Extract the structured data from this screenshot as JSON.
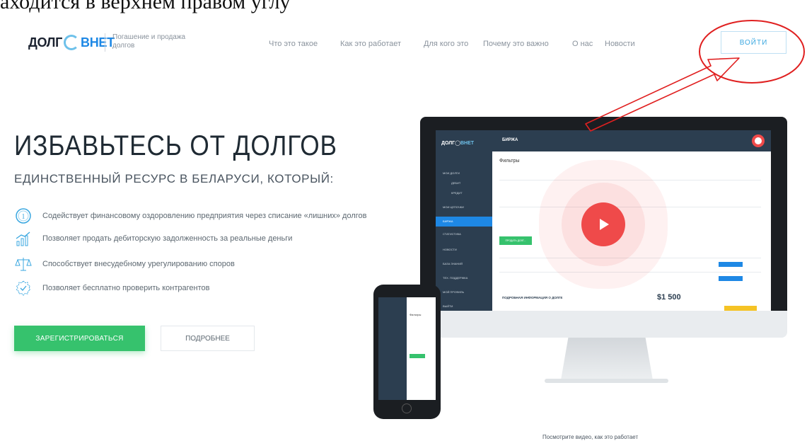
{
  "caption": "аходится в верхнем правом углу",
  "header": {
    "logo_left": "ДОЛГ",
    "logo_right": "ВНЕТ",
    "tagline": "Погашение и продажа долгов",
    "nav": [
      "Что это такое",
      "Как это работает",
      "Для кого это",
      "Почему это важно",
      "О нас",
      "Новости"
    ],
    "login": "ВОЙТИ"
  },
  "hero": {
    "title": "ИЗБАВЬТЕСЬ ОТ ДОЛГОВ",
    "subtitle": "ЕДИНСТВЕННЫЙ РЕСУРС В БЕЛАРУСИ, КОТОРЫЙ:",
    "features": [
      {
        "icon": "one-circle-icon",
        "text": "Содействует финансовому оздоровлению предприятия через списание «лишних» долгов"
      },
      {
        "icon": "growth-chart-icon",
        "text": "Позволяет продать дебиторскую задолженность за реальные деньги"
      },
      {
        "icon": "scales-icon",
        "text": "Способствует внесудебному урегулированию споров"
      },
      {
        "icon": "check-badge-icon",
        "text": "Позволяет бесплатно проверить контрагентов"
      }
    ],
    "register": "ЗАРЕГИСТРИРОВАТЬСЯ",
    "more": "ПОДРОБНЕЕ"
  },
  "mockup": {
    "screen_title": "БИРЖА",
    "filters_label": "Фильтры",
    "sell_button": "ПРОДАТЬ ДОЛГ...",
    "detail_header": "ПОДРОБНАЯ ИНФОРМАЦИЯ О ДОЛГЕ",
    "price": "$1 500",
    "sidebar_items": [
      "МОИ ДОЛГИ",
      "ДЕБИТ",
      "КРЕДИТ",
      "МОИ ЦЕПОЧКИ",
      "БИРЖА",
      "СТАТИСТИКА",
      "НОВОСТИ",
      "БАЗА ЗНАНИЙ",
      "ТЕХ. ПОДДЕРЖКА",
      "МОЙ ПРОФИЛЬ",
      "ВЫЙТИ"
    ]
  },
  "video_caption": "Посмотрите видео, как это работает",
  "colors": {
    "accent_green": "#36c26d",
    "accent_blue": "#3aa7e0",
    "annotation_red": "#e02020",
    "play_red": "#ef4a4a"
  }
}
